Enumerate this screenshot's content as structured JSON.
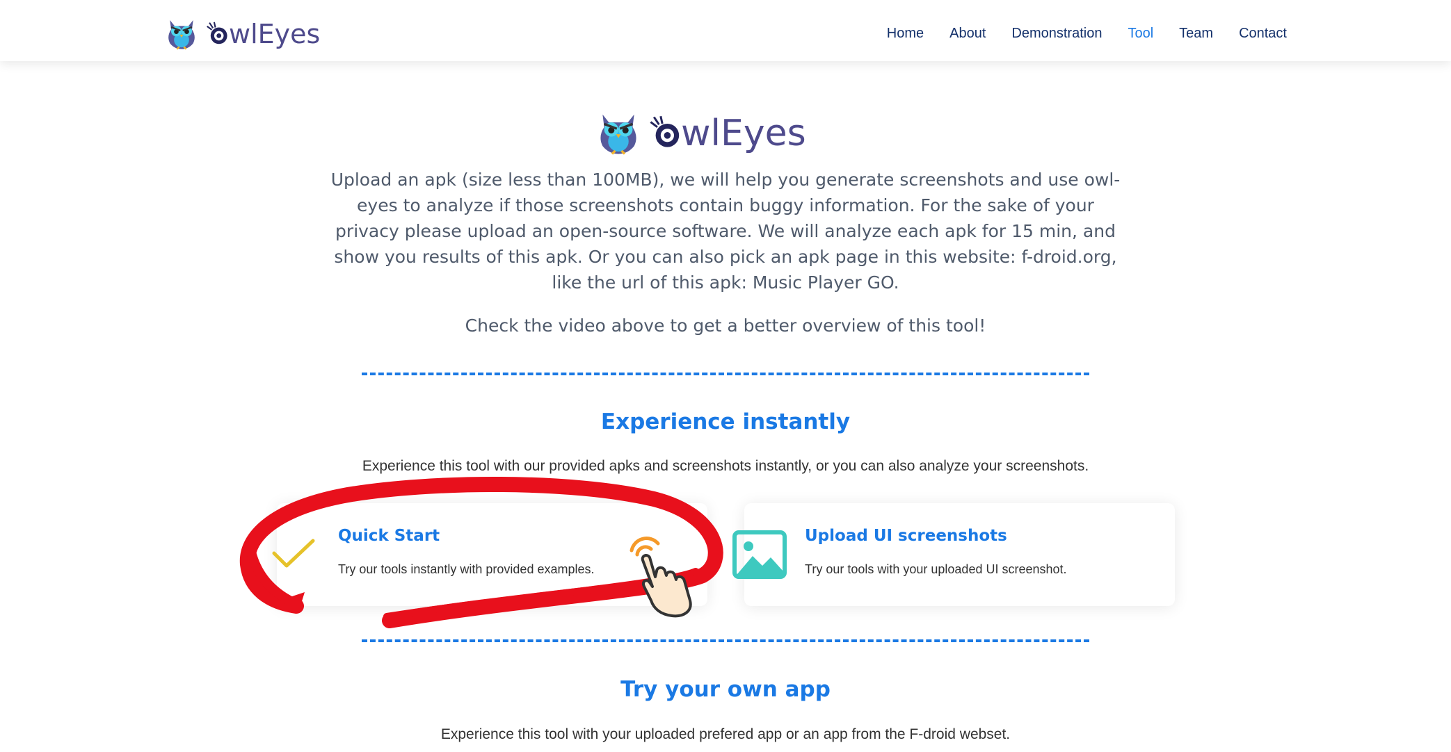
{
  "header": {
    "brand_text": "wlEyes",
    "nav": [
      "Home",
      "About",
      "Demonstration",
      "Tool",
      "Team",
      "Contact"
    ],
    "active_nav": "Tool"
  },
  "hero": {
    "logo_text": "wlEyes",
    "intro": "Upload an apk (size less than 100MB), we will help you generate screenshots and use owl-eyes to analyze if those screenshots contain buggy information. For the sake of your privacy please upload an open-source software. We will analyze each apk for 15 min, and show you results of this apk. Or you can also pick an apk page in this website: f-droid.org, like the url of this apk: Music Player GO.",
    "video_note": "Check the video above to get a better overview of this tool!"
  },
  "experience": {
    "title": "Experience instantly",
    "description": "Experience this tool with our provided apks and screenshots instantly, or you can also analyze your screenshots.",
    "cards": [
      {
        "title": "Quick Start",
        "text": "Try our tools instantly with provided examples.",
        "icon": "checkmark-icon"
      },
      {
        "title": "Upload UI screenshots",
        "text": "Try our tools with your uploaded UI screenshot.",
        "icon": "image-icon"
      }
    ]
  },
  "own_app": {
    "title": "Try your own app",
    "description": "Experience this tool with your uploaded prefered app or an app from the F-droid webset."
  },
  "colors": {
    "accent": "#1a79e4",
    "nav_text": "#14316b",
    "brand": "#4e4a8c",
    "annotation": "#e8101c",
    "check": "#e6c22a",
    "image_icon": "#3ec9bf"
  },
  "annotation": {
    "type": "red-circle-highlight",
    "pointer": "hand-pointer-icon"
  }
}
